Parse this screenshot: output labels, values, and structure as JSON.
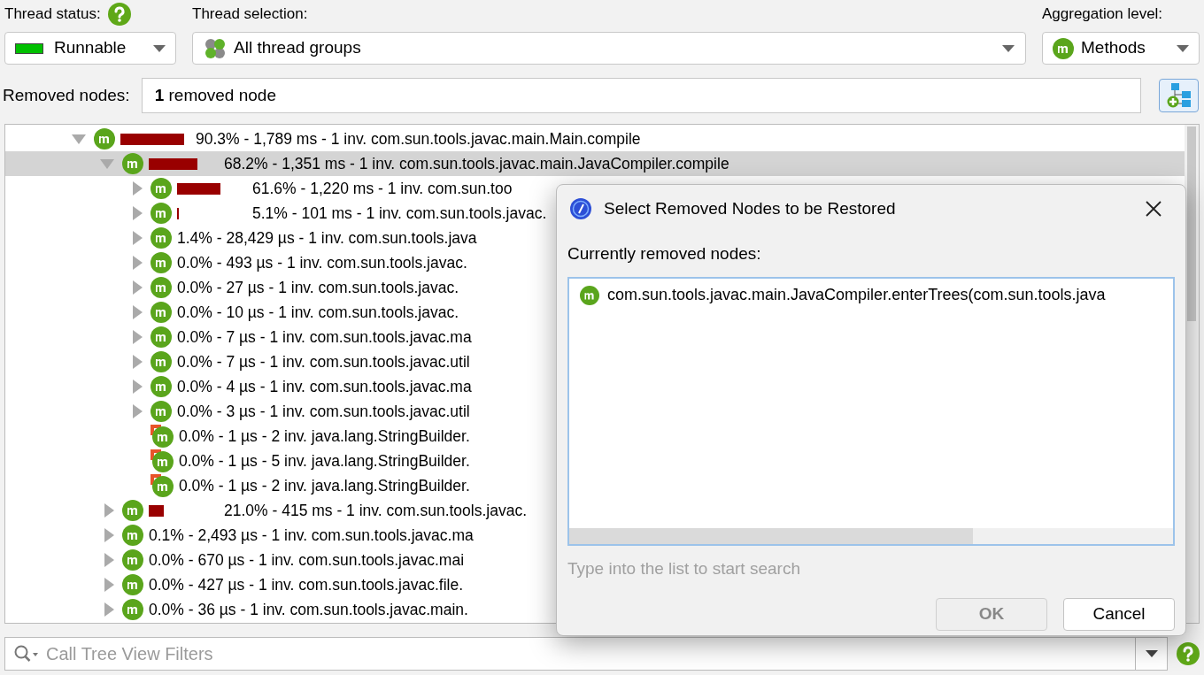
{
  "thread_status": {
    "label": "Thread status:",
    "value": "Runnable",
    "color": "#00c000"
  },
  "thread_selection": {
    "label": "Thread selection:",
    "value": "All thread groups"
  },
  "aggregation": {
    "label": "Aggregation level:",
    "value": "Methods"
  },
  "removed_nodes": {
    "label": "Removed nodes:",
    "value": "**1** removed node"
  },
  "tree": [
    {
      "kind": "node",
      "expanded": true,
      "selected": false,
      "level": 0.903,
      "text": "90.3% - 1,789 ms - 1 inv. com.sun.tools.javac.main.Main.compile",
      "children": [
        {
          "kind": "node",
          "expanded": true,
          "selected": true,
          "level": 0.682,
          "text": "68.2% - 1,351 ms - 1 inv. com.sun.tools.javac.main.JavaCompiler.compile",
          "children": [
            {
              "kind": "node",
              "expanded": false,
              "selected": false,
              "level": 0.616,
              "text": "61.6% - 1,220 ms - 1 inv. com.sun.too"
            },
            {
              "kind": "node",
              "expanded": false,
              "selected": false,
              "level": 0.03,
              "text": "5.1% - 101 ms - 1 inv. com.sun.tools.javac."
            },
            {
              "kind": "node",
              "expanded": false,
              "selected": false,
              "text": "1.4% - 28,429 µs - 1 inv. com.sun.tools.java"
            },
            {
              "kind": "node",
              "expanded": false,
              "selected": false,
              "text": "0.0% - 493 µs - 1 inv. com.sun.tools.javac."
            },
            {
              "kind": "node",
              "expanded": false,
              "selected": false,
              "text": "0.0% - 27 µs - 1 inv. com.sun.tools.javac."
            },
            {
              "kind": "node",
              "expanded": false,
              "selected": false,
              "text": "0.0% - 10 µs - 1 inv. com.sun.tools.javac."
            },
            {
              "kind": "node",
              "expanded": false,
              "selected": false,
              "text": "0.0% - 7 µs - 1 inv. com.sun.tools.javac.ma"
            },
            {
              "kind": "node",
              "expanded": false,
              "selected": false,
              "text": "0.0% - 7 µs - 1 inv. com.sun.tools.javac.util"
            },
            {
              "kind": "node",
              "expanded": false,
              "selected": false,
              "text": "0.0% - 4 µs - 1 inv. com.sun.tools.javac.ma"
            },
            {
              "kind": "node",
              "expanded": false,
              "selected": false,
              "text": "0.0% - 3 µs - 1 inv. com.sun.tools.javac.util"
            },
            {
              "kind": "leaf",
              "selected": false,
              "text": "0.0% - 1 µs - 2 inv. java.lang.StringBuilder."
            },
            {
              "kind": "leaf",
              "selected": false,
              "text": "0.0% - 1 µs - 5 inv. java.lang.StringBuilder."
            },
            {
              "kind": "leaf",
              "selected": false,
              "text": "0.0% - 1 µs - 2 inv. java.lang.StringBuilder."
            }
          ]
        },
        {
          "kind": "node",
          "expanded": false,
          "selected": false,
          "level": 0.21,
          "text": "21.0% - 415 ms - 1 inv. com.sun.tools.javac."
        },
        {
          "kind": "node",
          "expanded": false,
          "selected": false,
          "text": "0.1% - 2,493 µs - 1 inv. com.sun.tools.javac.ma"
        },
        {
          "kind": "node",
          "expanded": false,
          "selected": false,
          "text": "0.0% - 670 µs - 1 inv. com.sun.tools.javac.mai"
        },
        {
          "kind": "node",
          "expanded": false,
          "selected": false,
          "text": "0.0% - 427 µs - 1 inv. com.sun.tools.javac.file."
        },
        {
          "kind": "node",
          "expanded": false,
          "selected": false,
          "text": "0.0% - 36 µs - 1 inv. com.sun.tools.javac.main."
        }
      ]
    }
  ],
  "filter": {
    "placeholder": "Call Tree View Filters"
  },
  "dialog": {
    "title": "Select Removed Nodes to be Restored",
    "list_label": "Currently removed nodes:",
    "items": [
      {
        "text": "com.sun.tools.javac.main.JavaCompiler.enterTrees(com.sun.tools.java",
        "selected": false
      }
    ],
    "hint": "Type into the list to start search",
    "buttons": [
      {
        "label": "OK",
        "disabled": true
      },
      {
        "label": "Cancel",
        "disabled": false
      }
    ]
  }
}
